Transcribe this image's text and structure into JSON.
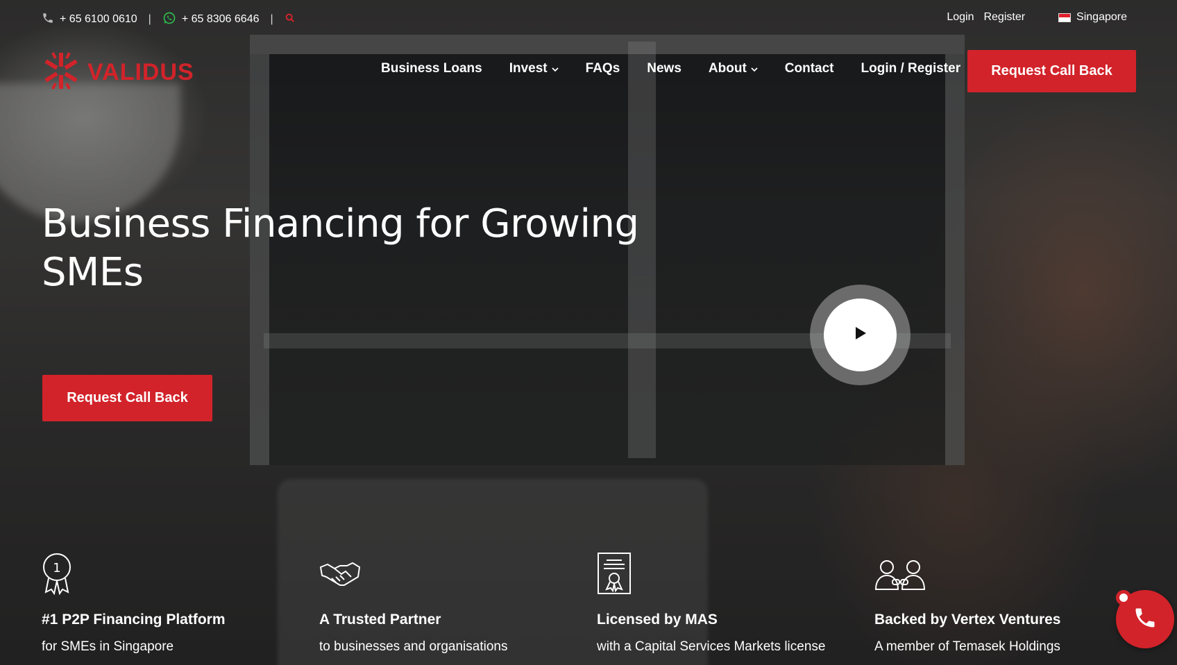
{
  "topbar": {
    "phone": "+ 65 6100 0610",
    "whatsapp": "+ 65 8306 6646",
    "divider": "|",
    "login": "Login",
    "register": "Register",
    "country": "Singapore"
  },
  "brand": {
    "name": "VALIDUS",
    "accent_color": "#d2232a"
  },
  "nav": {
    "items": [
      {
        "label": "Business Loans",
        "has_dropdown": false
      },
      {
        "label": "Invest",
        "has_dropdown": true
      },
      {
        "label": "FAQs",
        "has_dropdown": false
      },
      {
        "label": "News",
        "has_dropdown": false
      },
      {
        "label": "About",
        "has_dropdown": true
      },
      {
        "label": "Contact",
        "has_dropdown": false
      },
      {
        "label": "Login / Register",
        "has_dropdown": false
      }
    ],
    "cta": "Request Call Back"
  },
  "hero": {
    "title_line1": "Business Financing for Growing",
    "title_line2": "SMEs",
    "cta": "Request Call Back"
  },
  "features": [
    {
      "icon": "award-ribbon-icon",
      "title": "#1 P2P Financing Platform",
      "subtitle": "for SMEs in Singapore"
    },
    {
      "icon": "handshake-icon",
      "title": "A Trusted Partner",
      "subtitle": "to businesses and organisations"
    },
    {
      "icon": "certificate-icon",
      "title": "Licensed by MAS",
      "subtitle": "with a Capital Services Markets license"
    },
    {
      "icon": "partners-icon",
      "title": "Backed by Vertex Ventures",
      "subtitle": "A member of Temasek Holdings"
    }
  ]
}
